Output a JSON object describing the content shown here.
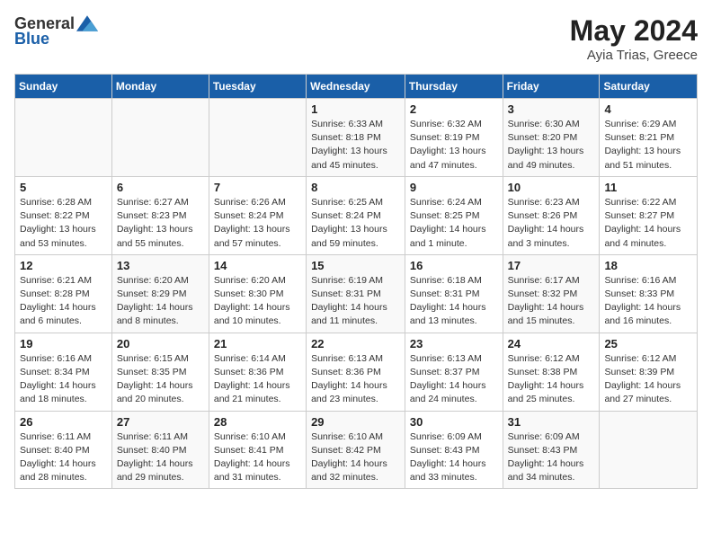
{
  "header": {
    "logo_general": "General",
    "logo_blue": "Blue",
    "title": "May 2024",
    "subtitle": "Ayia Trias, Greece"
  },
  "weekdays": [
    "Sunday",
    "Monday",
    "Tuesday",
    "Wednesday",
    "Thursday",
    "Friday",
    "Saturday"
  ],
  "weeks": [
    [
      {
        "day": "",
        "info": ""
      },
      {
        "day": "",
        "info": ""
      },
      {
        "day": "",
        "info": ""
      },
      {
        "day": "1",
        "info": "Sunrise: 6:33 AM\nSunset: 8:18 PM\nDaylight: 13 hours\nand 45 minutes."
      },
      {
        "day": "2",
        "info": "Sunrise: 6:32 AM\nSunset: 8:19 PM\nDaylight: 13 hours\nand 47 minutes."
      },
      {
        "day": "3",
        "info": "Sunrise: 6:30 AM\nSunset: 8:20 PM\nDaylight: 13 hours\nand 49 minutes."
      },
      {
        "day": "4",
        "info": "Sunrise: 6:29 AM\nSunset: 8:21 PM\nDaylight: 13 hours\nand 51 minutes."
      }
    ],
    [
      {
        "day": "5",
        "info": "Sunrise: 6:28 AM\nSunset: 8:22 PM\nDaylight: 13 hours\nand 53 minutes."
      },
      {
        "day": "6",
        "info": "Sunrise: 6:27 AM\nSunset: 8:23 PM\nDaylight: 13 hours\nand 55 minutes."
      },
      {
        "day": "7",
        "info": "Sunrise: 6:26 AM\nSunset: 8:24 PM\nDaylight: 13 hours\nand 57 minutes."
      },
      {
        "day": "8",
        "info": "Sunrise: 6:25 AM\nSunset: 8:24 PM\nDaylight: 13 hours\nand 59 minutes."
      },
      {
        "day": "9",
        "info": "Sunrise: 6:24 AM\nSunset: 8:25 PM\nDaylight: 14 hours\nand 1 minute."
      },
      {
        "day": "10",
        "info": "Sunrise: 6:23 AM\nSunset: 8:26 PM\nDaylight: 14 hours\nand 3 minutes."
      },
      {
        "day": "11",
        "info": "Sunrise: 6:22 AM\nSunset: 8:27 PM\nDaylight: 14 hours\nand 4 minutes."
      }
    ],
    [
      {
        "day": "12",
        "info": "Sunrise: 6:21 AM\nSunset: 8:28 PM\nDaylight: 14 hours\nand 6 minutes."
      },
      {
        "day": "13",
        "info": "Sunrise: 6:20 AM\nSunset: 8:29 PM\nDaylight: 14 hours\nand 8 minutes."
      },
      {
        "day": "14",
        "info": "Sunrise: 6:20 AM\nSunset: 8:30 PM\nDaylight: 14 hours\nand 10 minutes."
      },
      {
        "day": "15",
        "info": "Sunrise: 6:19 AM\nSunset: 8:31 PM\nDaylight: 14 hours\nand 11 minutes."
      },
      {
        "day": "16",
        "info": "Sunrise: 6:18 AM\nSunset: 8:31 PM\nDaylight: 14 hours\nand 13 minutes."
      },
      {
        "day": "17",
        "info": "Sunrise: 6:17 AM\nSunset: 8:32 PM\nDaylight: 14 hours\nand 15 minutes."
      },
      {
        "day": "18",
        "info": "Sunrise: 6:16 AM\nSunset: 8:33 PM\nDaylight: 14 hours\nand 16 minutes."
      }
    ],
    [
      {
        "day": "19",
        "info": "Sunrise: 6:16 AM\nSunset: 8:34 PM\nDaylight: 14 hours\nand 18 minutes."
      },
      {
        "day": "20",
        "info": "Sunrise: 6:15 AM\nSunset: 8:35 PM\nDaylight: 14 hours\nand 20 minutes."
      },
      {
        "day": "21",
        "info": "Sunrise: 6:14 AM\nSunset: 8:36 PM\nDaylight: 14 hours\nand 21 minutes."
      },
      {
        "day": "22",
        "info": "Sunrise: 6:13 AM\nSunset: 8:36 PM\nDaylight: 14 hours\nand 23 minutes."
      },
      {
        "day": "23",
        "info": "Sunrise: 6:13 AM\nSunset: 8:37 PM\nDaylight: 14 hours\nand 24 minutes."
      },
      {
        "day": "24",
        "info": "Sunrise: 6:12 AM\nSunset: 8:38 PM\nDaylight: 14 hours\nand 25 minutes."
      },
      {
        "day": "25",
        "info": "Sunrise: 6:12 AM\nSunset: 8:39 PM\nDaylight: 14 hours\nand 27 minutes."
      }
    ],
    [
      {
        "day": "26",
        "info": "Sunrise: 6:11 AM\nSunset: 8:40 PM\nDaylight: 14 hours\nand 28 minutes."
      },
      {
        "day": "27",
        "info": "Sunrise: 6:11 AM\nSunset: 8:40 PM\nDaylight: 14 hours\nand 29 minutes."
      },
      {
        "day": "28",
        "info": "Sunrise: 6:10 AM\nSunset: 8:41 PM\nDaylight: 14 hours\nand 31 minutes."
      },
      {
        "day": "29",
        "info": "Sunrise: 6:10 AM\nSunset: 8:42 PM\nDaylight: 14 hours\nand 32 minutes."
      },
      {
        "day": "30",
        "info": "Sunrise: 6:09 AM\nSunset: 8:43 PM\nDaylight: 14 hours\nand 33 minutes."
      },
      {
        "day": "31",
        "info": "Sunrise: 6:09 AM\nSunset: 8:43 PM\nDaylight: 14 hours\nand 34 minutes."
      },
      {
        "day": "",
        "info": ""
      }
    ]
  ]
}
